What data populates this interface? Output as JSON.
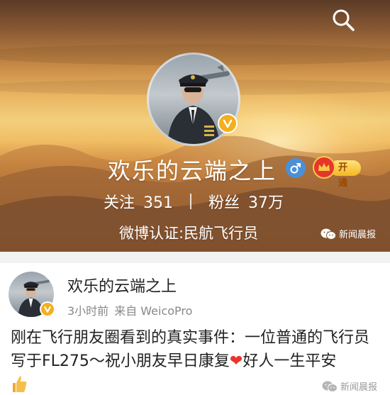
{
  "header": {
    "profile_name": "欢乐的云端之上",
    "vip_label": "开通",
    "following_label": "关注",
    "following_count": "351",
    "followers_label": "粉丝",
    "followers_count": "37万",
    "verification": "微博认证:民航飞行员",
    "watermark": "新闻晨报",
    "icons": [
      "search-icon",
      "verified-icon",
      "male-icon",
      "vip-crown-icon",
      "wechat-icon"
    ]
  },
  "post": {
    "author": "欢乐的云端之上",
    "time": "3小时前",
    "source": "来自 WeicoPro",
    "text_part1": "刚在飞行朋友圈看到的真实事件：一位普通的飞行员写于FL275～祝小朋友早日康复",
    "text_heart": "❤",
    "text_part2": "好人一生平安",
    "watermark": "新闻晨报"
  },
  "colors": {
    "verified_badge": "#f2b01e",
    "gender_badge": "#4a90d9",
    "heart": "#e8352b"
  }
}
